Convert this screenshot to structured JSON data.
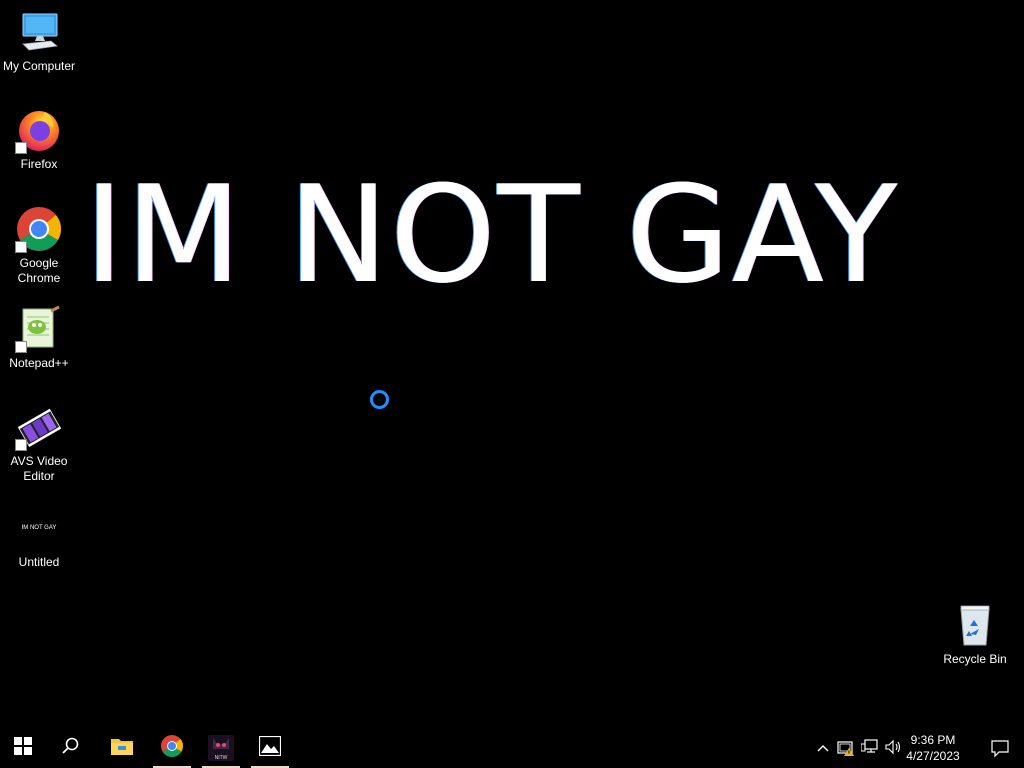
{
  "desktop": {
    "wallpaper_text": "IM NOT GAY",
    "icons": [
      {
        "label": "My Computer",
        "icon": "my-computer-icon"
      },
      {
        "label": "Firefox",
        "icon": "firefox-icon"
      },
      {
        "label": "Google Chrome",
        "icon": "chrome-icon"
      },
      {
        "label": "Notepad++",
        "icon": "notepadpp-icon"
      },
      {
        "label": "AVS Video Editor",
        "icon": "avs-video-editor-icon"
      },
      {
        "label": "Untitled",
        "icon": "image-file-thumbnail-icon",
        "thumbnail_text": "IM NOT GAY"
      }
    ],
    "recycle_bin": {
      "label": "Recycle Bin",
      "icon": "recycle-bin-icon"
    }
  },
  "taskbar": {
    "buttons": [
      {
        "icon": "windows-start-icon"
      },
      {
        "icon": "search-icon"
      },
      {
        "icon": "file-explorer-icon"
      },
      {
        "icon": "chrome-icon"
      },
      {
        "icon": "nitw-app-icon",
        "badge_text": "NITW"
      },
      {
        "icon": "photos-icon"
      }
    ],
    "tray": {
      "icons": [
        "chevron-up-icon",
        "security-warning-icon",
        "network-icon",
        "volume-icon"
      ],
      "time": "9:36 PM",
      "date": "4/27/2023"
    }
  },
  "colors": {
    "accent_ring": "#1e90ff",
    "taskbar_bg": "#000000",
    "desktop_bg": "#000000"
  }
}
